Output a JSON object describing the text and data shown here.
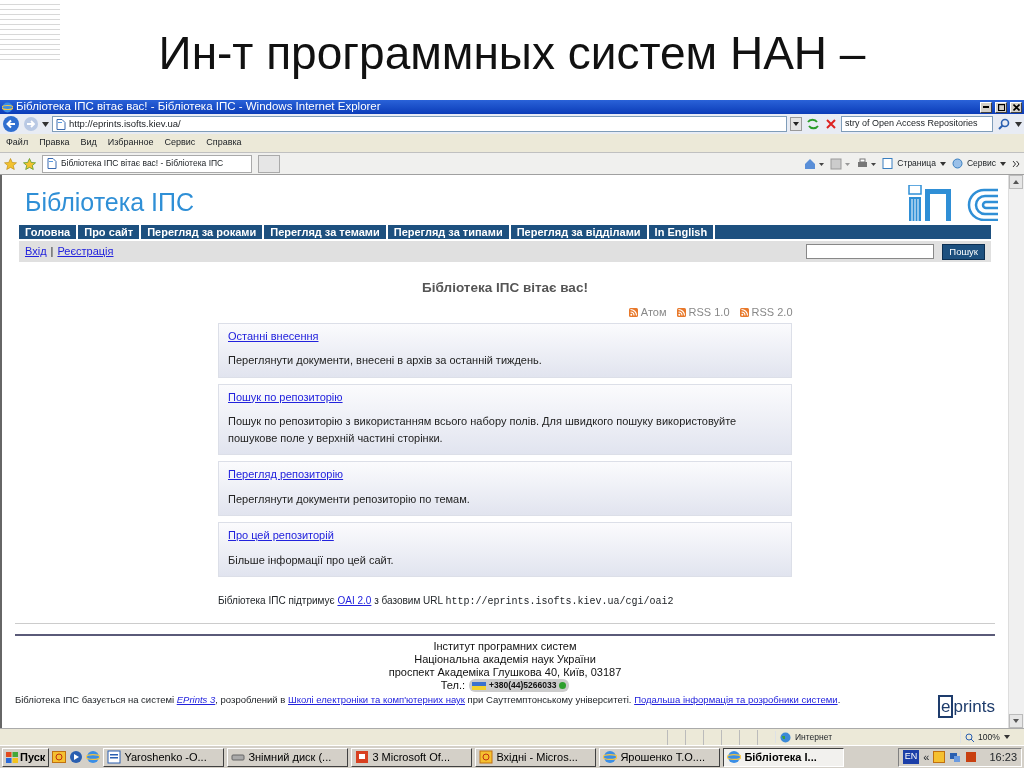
{
  "slide_title": "Ин-т программных систем НАН –",
  "window": {
    "title": "Бібліотека ІПС вітає вас! - Бібліотека ІПС - Windows Internet Explorer"
  },
  "address": {
    "url": "http://eprints.isofts.kiev.ua/",
    "search_value": "stry of Open Access Repositories"
  },
  "menu": [
    "Файл",
    "Правка",
    "Вид",
    "Избранное",
    "Сервис",
    "Справка"
  ],
  "tab": {
    "label": "Бібліотека ІПС вітає вас! - Бібліотека ІПС"
  },
  "command_bar": [
    "Страница",
    "Сервис"
  ],
  "page": {
    "site_title": "Бібліотека ІПС",
    "nav": [
      "Головна",
      "Про сайт",
      "Перегляд за роками",
      "Перегляд за темами",
      "Перегляд за типами",
      "Перегляд за відділами",
      "In English"
    ],
    "login_links": [
      "Вхід",
      "Реєстрація"
    ],
    "login_separator": "|",
    "search_button": "Пошук",
    "heading": "Бібліотека ІПС вітає вас!",
    "feeds": [
      "Атом",
      "RSS 1.0",
      "RSS 2.0"
    ],
    "sections": [
      {
        "link": "Останні внесення",
        "text": "Переглянути документи, внесені в архів за останній тиждень."
      },
      {
        "link": "Пошук по репозиторію",
        "text": "Пошук по репозиторію з використанням всього набору полів. Для швидкого пошуку використовуйте пошукове поле у верхній частині сторінки."
      },
      {
        "link": "Перегляд репозиторію",
        "text": "Переглянути документи репозиторію по темам."
      },
      {
        "link": "Про цей репозиторій",
        "text": "Більше інформації про цей сайт."
      }
    ],
    "oai": {
      "before": "Бібліотека ІПС підтримує ",
      "link": "OAI 2.0",
      "after": " з базовим URL ",
      "url": "http://eprints.isofts.kiev.ua/cgi/oai2"
    },
    "footer": {
      "lines": [
        "Інститут програмних систем",
        "Національна академія наук України",
        "проспект Академіка Глушкова 40, Київ, 03187"
      ],
      "phone_label": "Тел.:",
      "phone": "+380(44)5266033",
      "credits": [
        {
          "text": "Бібліотека ІПС базується на системі ",
          "kind": "plain"
        },
        {
          "text": "EPrints 3",
          "kind": "italic_link"
        },
        {
          "text": ", розроблений в ",
          "kind": "plain"
        },
        {
          "text": "Школі електроніки та комп'ютерних наук",
          "kind": "link"
        },
        {
          "text": " при Саутгемптонському університеті. ",
          "kind": "plain"
        },
        {
          "text": "Подальша інформація та розробники системи",
          "kind": "link"
        },
        {
          "text": ".",
          "kind": "plain"
        }
      ],
      "logo": "eprints"
    }
  },
  "status_bar": {
    "zone": "Интернет",
    "zoom": "100%"
  },
  "taskbar": {
    "start": "Пуск",
    "items": [
      {
        "label": "Yaroshenko -O...",
        "selected": false
      },
      {
        "label": "Знімний диск (...",
        "selected": false
      },
      {
        "label": "3 Microsoft Of...",
        "selected": false
      },
      {
        "label": "Вхідні - Micros...",
        "selected": false
      },
      {
        "label": "Ярошенко Т.О....",
        "selected": false
      },
      {
        "label": "Бібліотека І...",
        "selected": true
      }
    ],
    "lang": "EN",
    "more": "«",
    "clock": "16:23"
  }
}
